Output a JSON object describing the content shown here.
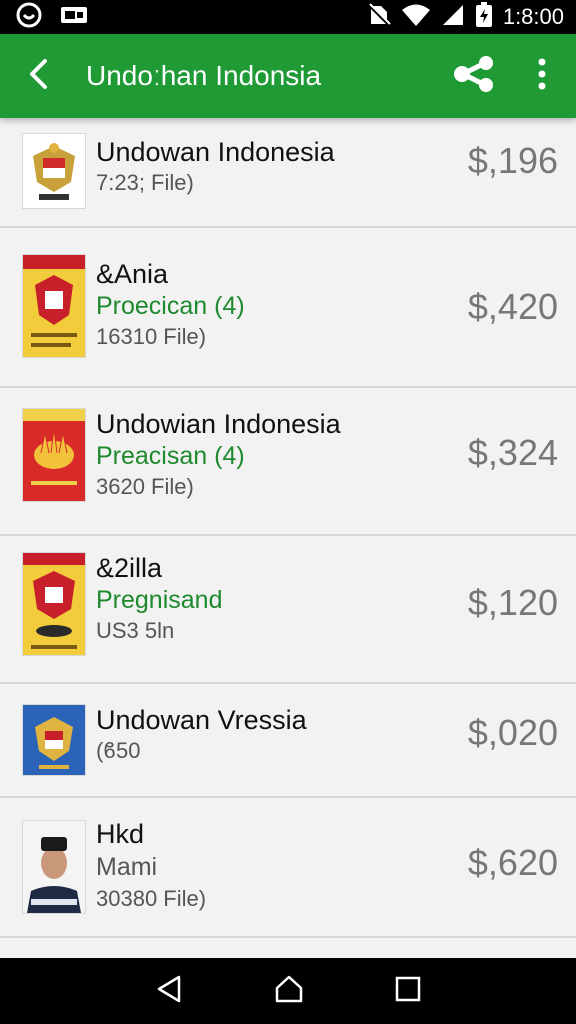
{
  "status_bar": {
    "time": "1:8:00",
    "left_icons": [
      "app-circle-icon",
      "video-icon"
    ],
    "right_icons": [
      "no-sim-icon",
      "wifi-icon",
      "signal-icon",
      "battery-icon"
    ]
  },
  "app_bar": {
    "title": "Undoːhan Indonsia",
    "back_icon": "chevron-left-icon",
    "share_icon": "share-icon",
    "more_icon": "more-vert-icon",
    "color": "#1f9a35"
  },
  "items": [
    {
      "title": "Undowan Indonesia",
      "subtitle": "",
      "meta": "7:23; File)",
      "price": "$,196",
      "thumb": "emblem-red-white"
    },
    {
      "title": "&Ania",
      "subtitle": "Proecican (4)",
      "meta": "16310 File)",
      "price": "$,420",
      "thumb": "emblem-yellow"
    },
    {
      "title": "Undowian Indonesia",
      "subtitle": "Preacisan (4)",
      "meta": "3620 File)",
      "price": "$,324",
      "thumb": "emblem-red-flame"
    },
    {
      "title": "&2illa",
      "subtitle": "Pregnisand",
      "meta": "US3 5ln",
      "price": "$,120",
      "thumb": "emblem-yellow-2"
    },
    {
      "title": "Undowan Vressia",
      "subtitle": "",
      "meta": "(ϐ50",
      "price": "$,020",
      "thumb": "emblem-blue"
    },
    {
      "title": "Hkd",
      "subtitle": "Mami",
      "meta": "30380 File)",
      "price": "$,620",
      "thumb": "person-portrait"
    }
  ],
  "nav_bar": {
    "icons": [
      "back-triangle-icon",
      "home-icon",
      "recents-square-icon"
    ]
  }
}
